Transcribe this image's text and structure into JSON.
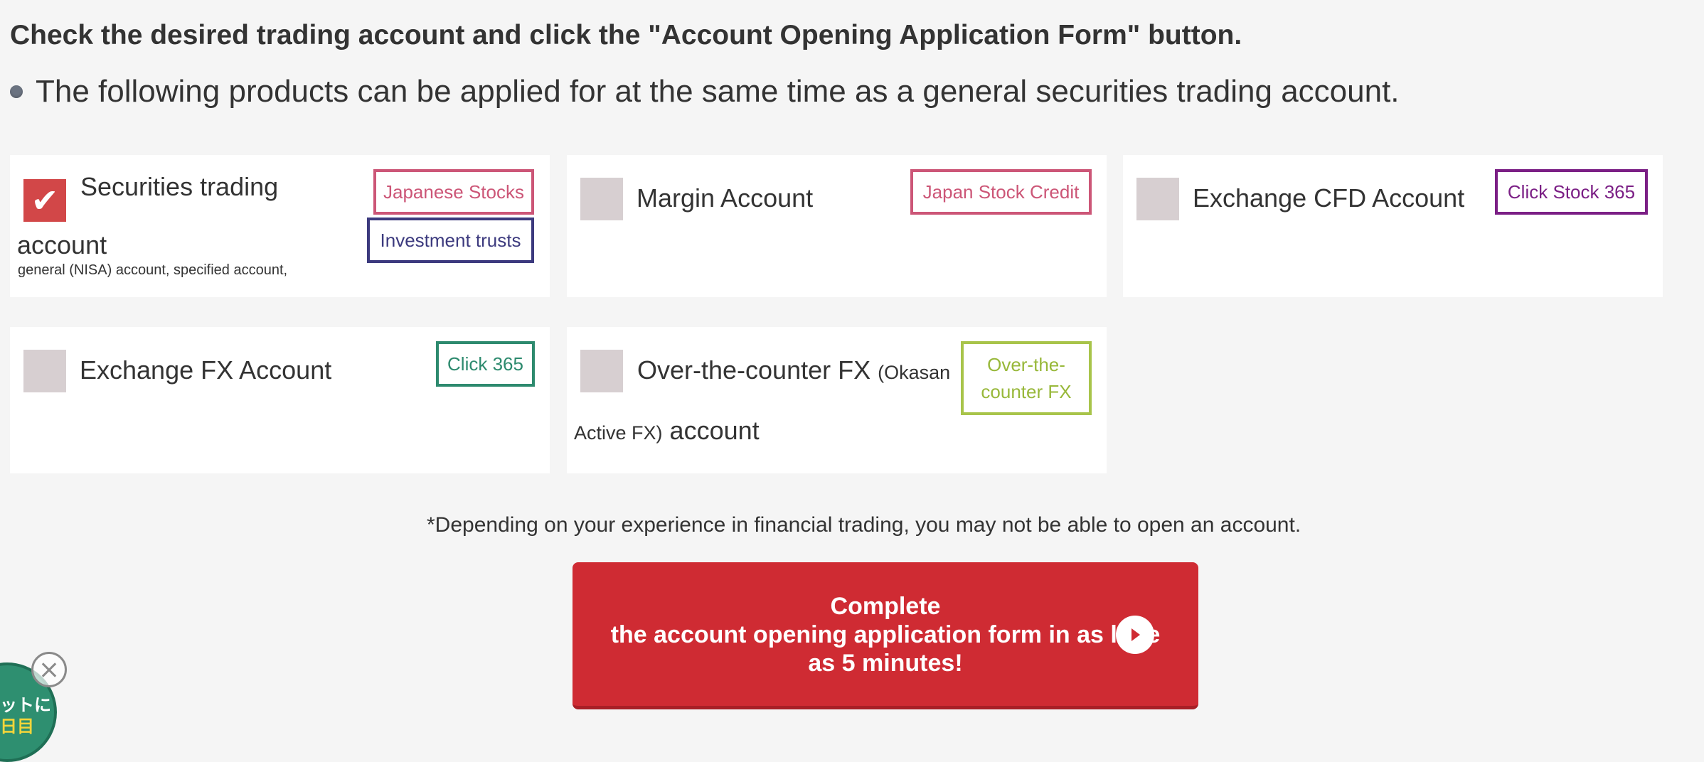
{
  "heading": "Check the desired trading account and click the \"Account Opening Application Form\" button.",
  "intro": "The following products can be applied for at the same time as a general securities trading account.",
  "accounts": [
    {
      "title": "Securities trading account",
      "sub": "general (NISA) account, specified account,",
      "checked": true,
      "tags": [
        "Japanese Stocks",
        "Investment trusts"
      ]
    },
    {
      "title": "Margin Account",
      "checked": false,
      "tags": [
        "Japan Stock Credit"
      ]
    },
    {
      "title": "Exchange CFD Account",
      "checked": false,
      "tags": [
        "Click Stock 365"
      ]
    },
    {
      "title": "Exchange FX Account",
      "checked": false,
      "tags": [
        "Click 365"
      ]
    },
    {
      "title_main": "Over-the-counter FX",
      "title_small": "(Okasan Active FX)",
      "title_end": "account",
      "checked": false,
      "tags": [
        "Over-the-counter FX"
      ]
    }
  ],
  "check_mark": "✔",
  "note": "*Depending on your experience in financial trading, you may not be able to open an account.",
  "cta": {
    "line1": "Complete",
    "line2": "the account opening application form in as little",
    "line3": "as 5 minutes!"
  },
  "promo": {
    "line1": "ットに",
    "line2": "日目"
  },
  "colors": {
    "cta": "#cf2b33",
    "checked": "#d24748",
    "unchecked": "#d7cfd1",
    "tag_pink": "#cc5677",
    "tag_navy": "#3c3a7e",
    "tag_purple": "#7b1f85",
    "tag_teal": "#2d8a6e",
    "tag_lime": "#a8c44a"
  }
}
